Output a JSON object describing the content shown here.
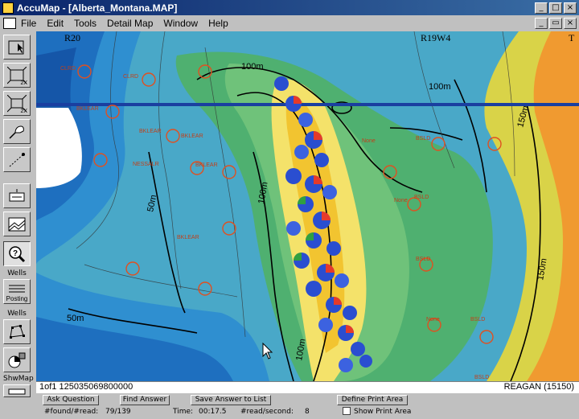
{
  "window": {
    "title": "AccuMap - [Alberta_Montana.MAP]"
  },
  "menu": [
    {
      "label": "File"
    },
    {
      "label": "Edit"
    },
    {
      "label": "Tools"
    },
    {
      "label": "Detail Map"
    },
    {
      "label": "Window"
    },
    {
      "label": "Help"
    }
  ],
  "toolbar": {
    "zoom_in_label": "2X",
    "zoom_out_label": "2X",
    "wells_label": "Wells",
    "posting_label": "Posting",
    "wells2_label": "Wells",
    "showmap_label": "ShwMap"
  },
  "map": {
    "range_left": "R20",
    "range_right": "R19W4",
    "corner_label": "T",
    "contours": [
      "100m",
      "100m",
      "50m",
      "100m",
      "150m",
      "150m",
      "100m",
      "50m"
    ],
    "well_labels": [
      "CLRD",
      "CLRD",
      "BKLEAR",
      "BKLEAR",
      "BKLEAR",
      "NESSALR",
      "BKLEAR",
      "BKLEAR",
      "None",
      "BSLD",
      "None",
      "BSLD",
      "None",
      "BSLD",
      "BSLD",
      "BSLD"
    ]
  },
  "status": {
    "left": "1of1 125035069800000",
    "right": "REAGAN (15150)"
  },
  "bottom": {
    "ask_question": "Ask Question",
    "find_answer": "Find Answer",
    "save_answer": "Save Answer to List",
    "define_print": "Define Print Area",
    "show_print": "Show Print Area",
    "found_label": "#found/#read:",
    "found_value": "79/139",
    "time_label": "Time:",
    "time_value": "00:17.5",
    "rate_label": "#read/second:",
    "rate_value": "8"
  }
}
